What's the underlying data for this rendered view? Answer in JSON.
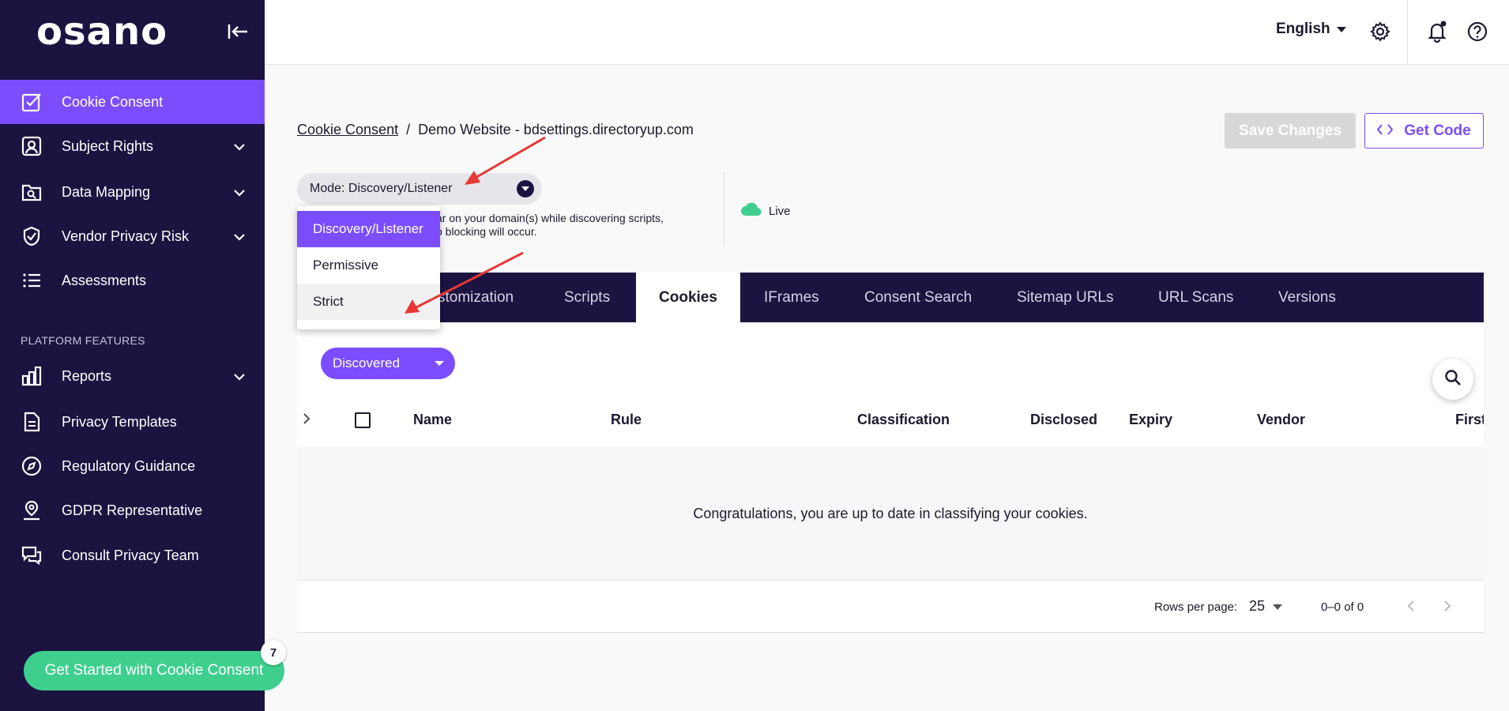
{
  "sidebar": {
    "logo": "osano",
    "items": [
      {
        "label": "Cookie Consent"
      },
      {
        "label": "Subject Rights"
      },
      {
        "label": "Data Mapping"
      },
      {
        "label": "Vendor Privacy Risk"
      },
      {
        "label": "Assessments"
      },
      {
        "label": "Reports"
      },
      {
        "label": "Privacy Templates"
      },
      {
        "label": "Regulatory Guidance"
      },
      {
        "label": "GDPR Representative"
      },
      {
        "label": "Consult Privacy Team"
      }
    ],
    "section_label": "PLATFORM FEATURES",
    "get_started": {
      "label": "Get Started with Cookie Consent",
      "badge": "7"
    }
  },
  "topbar": {
    "language": "English"
  },
  "breadcrumb": {
    "root": "Cookie Consent",
    "separator": "/",
    "current": "Demo Website - bdsettings.directoryup.com"
  },
  "actions": {
    "save": "Save Changes",
    "code": "Get Code"
  },
  "mode": {
    "label": "Mode: Discovery/Listener",
    "description_line1": "ar on your domain(s) while discovering scripts,",
    "description_line2": "o blocking will occur.",
    "options": [
      "Discovery/Listener",
      "Permissive",
      "Strict"
    ]
  },
  "status": {
    "label": "Live"
  },
  "tabs": [
    "stomization",
    "Scripts",
    "Cookies",
    "IFrames",
    "Consent Search",
    "Sitemap URLs",
    "URL Scans",
    "Versions"
  ],
  "table": {
    "filter": "Discovered",
    "columns": [
      "Name",
      "Rule",
      "Classification",
      "Disclosed",
      "Expiry",
      "Vendor",
      "First"
    ],
    "empty_message": "Congratulations, you are up to date in classifying your cookies.",
    "rows_per_page_label": "Rows per page:",
    "rows_per_page": "25",
    "range": "0–0 of 0"
  },
  "colors": {
    "sidebar": "#1c1340",
    "accent": "#7c4dff",
    "success": "#3ecf8e",
    "annotation": "#e53935"
  }
}
